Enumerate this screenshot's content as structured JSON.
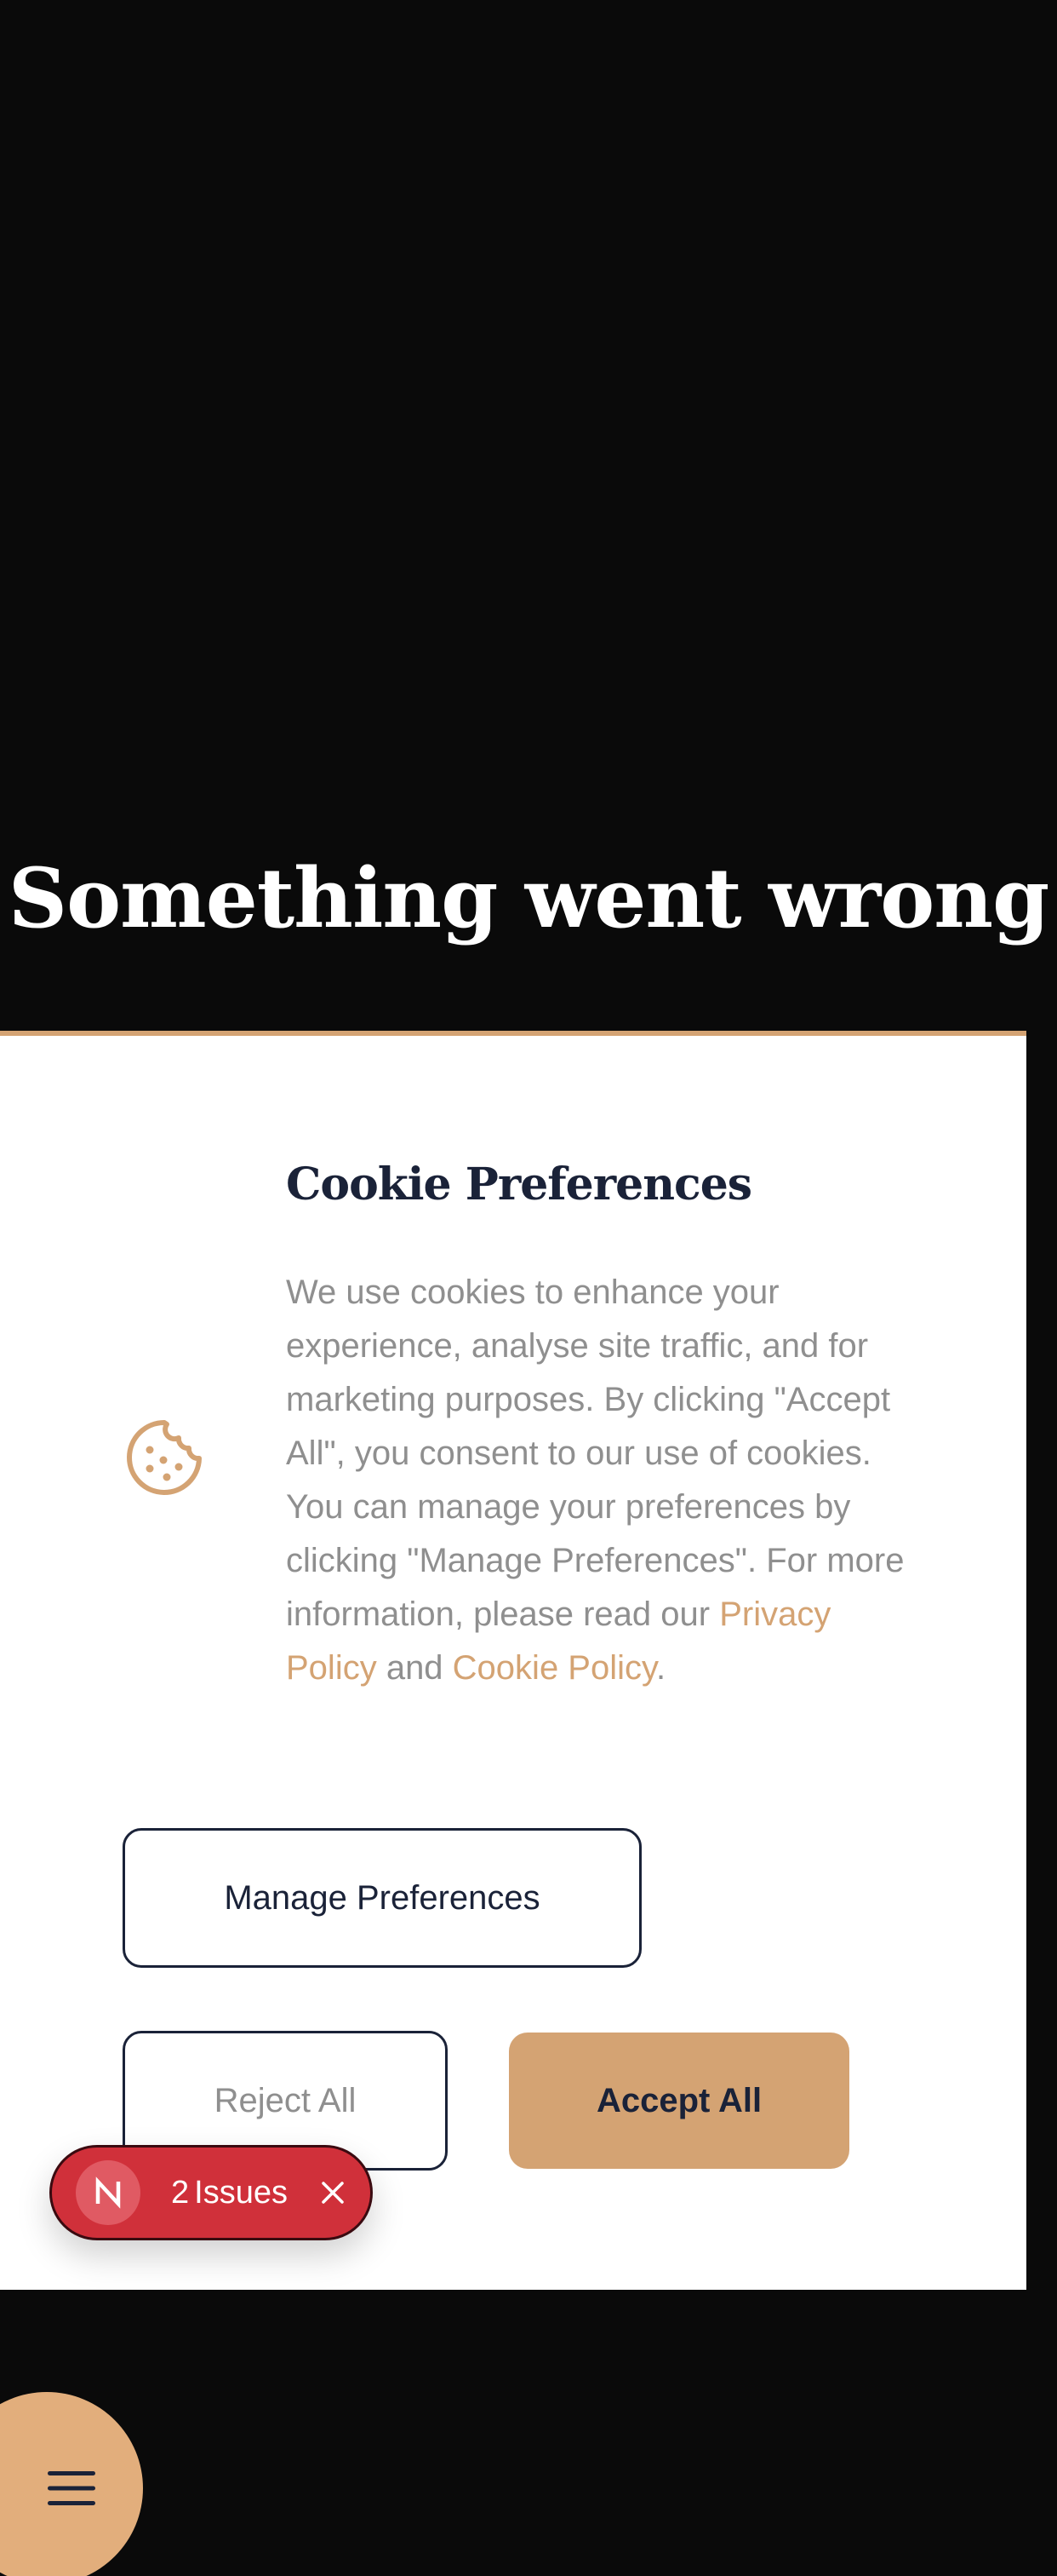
{
  "page": {
    "title": "Something went wrong"
  },
  "cookie_banner": {
    "icon": "cookie-icon",
    "title": "Cookie Preferences",
    "text_before_links": "We use cookies to enhance your experience, analyse site traffic, and for marketing purposes. By clicking \"Accept All\", you consent to our use of cookies. You can manage your preferences by clicking \"Manage Preferences\". For more information, please read our ",
    "privacy_link": "Privacy Policy",
    "text_between_links": " and ",
    "cookie_link": "Cookie Policy",
    "text_after_links": ".",
    "manage_button": "Manage Preferences",
    "reject_button": "Reject All",
    "accept_button": "Accept All",
    "accent_color": "#d4a373",
    "text_dark_color": "#1a2238"
  },
  "issues_badge": {
    "logo": "nextjs-n-icon",
    "count": "2",
    "label": "Issues",
    "close_icon": "close-icon",
    "color": "#d0303a"
  },
  "menu_button": {
    "icon": "hamburger-menu-icon",
    "color": "#e2ae7c"
  }
}
